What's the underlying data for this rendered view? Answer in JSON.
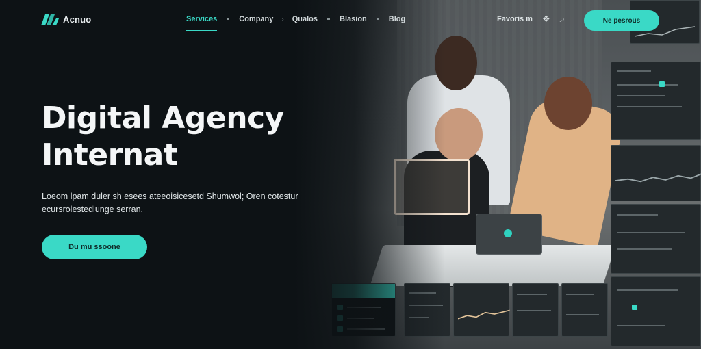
{
  "brand": {
    "name": "Acnuo"
  },
  "nav": {
    "items": [
      {
        "label": "Services",
        "active": true
      },
      {
        "label": "Company",
        "active": false
      },
      {
        "label": "Qualos",
        "active": false
      },
      {
        "label": "Blasion",
        "active": false
      },
      {
        "label": "Blog",
        "active": false
      }
    ],
    "right_link": "Favoris m",
    "icons": [
      "bookmark-icon",
      "search-icon"
    ],
    "cta_label": "Ne pesrous"
  },
  "hero": {
    "headline_line1": "Digital Agency",
    "headline_line2": "Internat",
    "body": "Loeom lpam duler sh esees ateeoisicesetd Shumwol; Oren cotestur ecursrolestedlunge serran.",
    "cta_label": "Du mu ssoone"
  },
  "colors": {
    "accent": "#3ad9c6",
    "background": "#0d1215",
    "text": "#f4f6f7"
  }
}
